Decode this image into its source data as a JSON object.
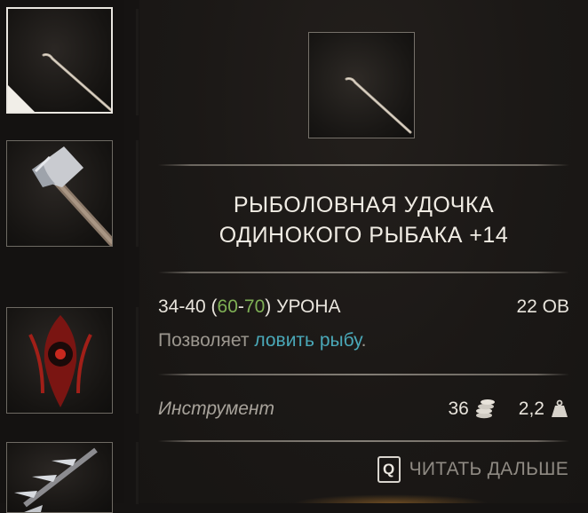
{
  "inventory": {
    "slots": [
      {
        "icon": "fishing-rod-icon",
        "selected": true
      },
      {
        "icon": "axe-icon",
        "selected": false
      },
      {
        "icon": "demon-emblem-icon",
        "selected": false
      },
      {
        "icon": "spiked-weapon-icon",
        "selected": false
      }
    ]
  },
  "tooltip": {
    "icon": "fishing-rod-icon",
    "title_line1": "РЫБОЛОВНАЯ УДОЧКА",
    "title_line2": "ОДИНОКОГО РЫБАКА +14",
    "damage": {
      "base": "34-40",
      "open_paren": " (",
      "bonus_min": "60",
      "dash": "-",
      "bonus_max": "70",
      "close_paren": ")",
      "label": " УРОНА"
    },
    "power": "22 ОВ",
    "description": {
      "prefix": "Позволяет ",
      "link": "ловить рыбу",
      "suffix": "."
    },
    "type": "Инструмент",
    "gold_value": "36",
    "weight": "2,2",
    "read_more": {
      "key": "Q",
      "label": "ЧИТАТЬ ДАЛЬШЕ"
    },
    "colors": {
      "bonus_green": "#7fb055",
      "link_teal": "#4aa8b8"
    }
  }
}
